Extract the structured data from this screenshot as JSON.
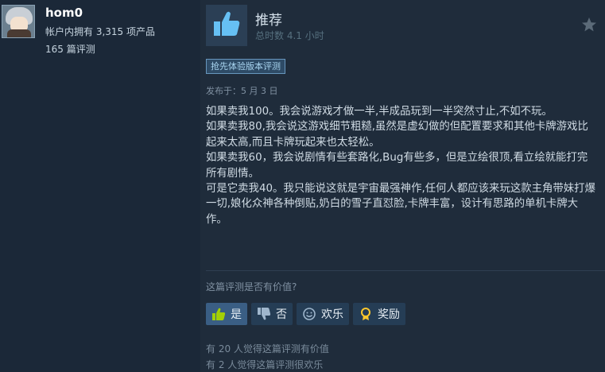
{
  "reviewer": {
    "name": "hom0",
    "products_owned": "帐户内拥有 3,315 项产品",
    "review_count": "165 篇评测"
  },
  "review": {
    "verdict": "推荐",
    "hours": "总时数 4.1 小时",
    "early_access_badge": "抢先体验版本评测",
    "posted": "发布于：5 月 3 日",
    "paragraphs": [
      "如果卖我100。我会说游戏才做一半,半成品玩到一半突然寸止,不如不玩。",
      "如果卖我80,我会说这游戏细节粗糙,虽然是虚幻做的但配置要求和其他卡牌游戏比起来太高,而且卡牌玩起来也太轻松。",
      "如果卖我60，我会说剧情有些套路化,Bug有些多，但是立绘很顶,看立绘就能打完所有剧情。",
      "可是它卖我40。我只能说这就是宇宙最强神作,任何人都应该来玩这款主角带妹打爆一切,娘化众神各种倒贴,奶白的雪子直怼脸,卡牌丰富，设计有思路的单机卡牌大作。"
    ]
  },
  "feedback": {
    "question": "这篇评测是否有价值?",
    "yes_label": "是",
    "no_label": "否",
    "funny_label": "欢乐",
    "award_label": "奖励",
    "helpful_count": "有 20 人觉得这篇评测有价值",
    "funny_count": "有 2 人觉得这篇评测很欢乐"
  },
  "icons": {
    "thumbs_up": "thumbs-up-icon",
    "star": "star-icon",
    "thumbs_down": "thumbs-down-icon",
    "smiley": "smiley-icon",
    "award": "award-icon"
  },
  "colors": {
    "background": "#1b2838",
    "review_panel": "#1f2c3b",
    "thumb_blue": "#66c0f4",
    "yes_active": "#3a5e84",
    "award_gold": "#ffc82c"
  }
}
